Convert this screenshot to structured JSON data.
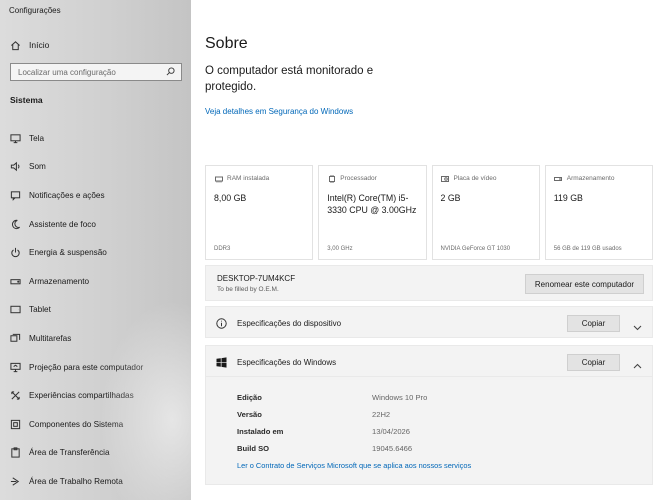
{
  "window": {
    "title": "Configurações"
  },
  "sidebar": {
    "home_label": "Início",
    "search_placeholder": "Localizar uma configuração",
    "section_label": "Sistema",
    "items": [
      {
        "label": "Tela",
        "icon": "monitor-icon"
      },
      {
        "label": "Som",
        "icon": "speaker-icon"
      },
      {
        "label": "Notificações e ações",
        "icon": "notification-icon"
      },
      {
        "label": "Assistente de foco",
        "icon": "moon-icon"
      },
      {
        "label": "Energia & suspensão",
        "icon": "power-icon"
      },
      {
        "label": "Armazenamento",
        "icon": "storage-icon"
      },
      {
        "label": "Tablet",
        "icon": "tablet-icon"
      },
      {
        "label": "Multitarefas",
        "icon": "multitask-icon"
      },
      {
        "label": "Projeção para este computador",
        "icon": "projection-icon"
      },
      {
        "label": "Experiências compartilhadas",
        "icon": "share-icon"
      },
      {
        "label": "Componentes do Sistema",
        "icon": "components-icon"
      },
      {
        "label": "Área de Transferência",
        "icon": "clipboard-icon"
      },
      {
        "label": "Área de Trabalho Remota",
        "icon": "remote-icon"
      }
    ]
  },
  "main": {
    "title": "Sobre",
    "protection_text": "O computador está monitorado e protegido.",
    "security_link": "Veja detalhes em Segurança do Windows",
    "cards": [
      {
        "label": "RAM instalada",
        "value": "8,00 GB",
        "sub": "DDR3",
        "icon": "ram-icon"
      },
      {
        "label": "Processador",
        "value": "Intel(R) Core(TM) i5-3330 CPU @ 3.00GHz",
        "sub": "3,00 GHz",
        "icon": "processor-icon"
      },
      {
        "label": "Placa de vídeo",
        "value": "2 GB",
        "sub": "NVIDIA GeForce GT 1030",
        "icon": "gpu-icon"
      },
      {
        "label": "Armazenamento",
        "value": "119 GB",
        "sub": "56 GB de 119 GB usados",
        "icon": "storage-icon"
      }
    ],
    "pc": {
      "name": "DESKTOP-7UM4KCF",
      "subtitle": "To be filled by O.E.M.",
      "rename_label": "Renomear este computador"
    },
    "device_specs": {
      "label": "Especificações do dispositivo",
      "copy_label": "Copiar"
    },
    "windows_specs": {
      "label": "Especificações do Windows",
      "copy_label": "Copiar",
      "rows": [
        {
          "key": "Edição",
          "value": "Windows 10 Pro"
        },
        {
          "key": "Versão",
          "value": "22H2"
        },
        {
          "key": "Instalado em",
          "value": "13/04/2026"
        },
        {
          "key": "Build SO",
          "value": "19045.6466"
        }
      ],
      "agreement_link": "Ler o Contrato de Serviços Microsoft que se aplica aos nossos serviços"
    }
  }
}
